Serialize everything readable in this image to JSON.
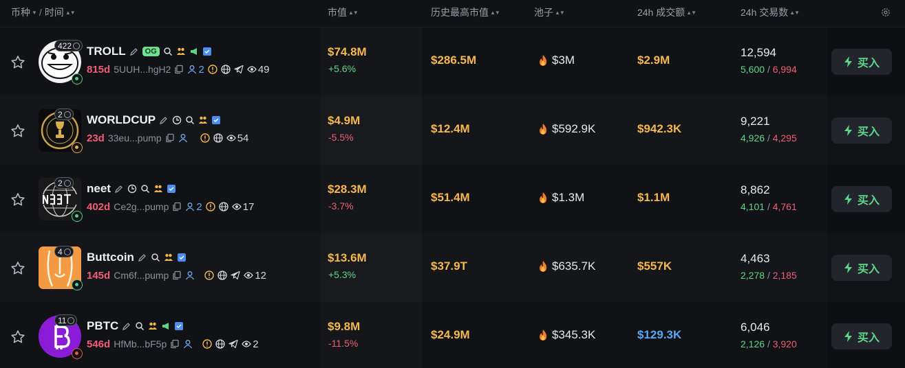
{
  "header": {
    "col_coin": "币种",
    "sep": "/",
    "col_time": "时间",
    "col_mcap": "市值",
    "col_ath": "历史最高市值",
    "col_pool": "池子",
    "col_volume": "24h 成交额",
    "col_txs": "24h 交易数"
  },
  "colors": {
    "accent_orange": "#f5b84c",
    "up": "#5ed68a",
    "down": "#f05e78",
    "blue": "#5aa6f5"
  },
  "buy_label": "买入",
  "rows": [
    {
      "holders": "422",
      "name": "TROLL",
      "og": "OG",
      "age": "815d",
      "address": "5UUH...hgH2",
      "holder_count": "2",
      "views": "49",
      "mcap": "$74.8M",
      "mcap_change": "+5.6%",
      "ath": "$286.5M",
      "pool": "$3M",
      "volume": "$2.9M",
      "txs": "12,594",
      "buys": "5,600",
      "slash": "/",
      "sells": "6,994"
    },
    {
      "holders": "2",
      "name": "WORLDCUP",
      "age": "23d",
      "address": "33eu...pump",
      "views": "54",
      "mcap": "$4.9M",
      "mcap_change": "-5.5%",
      "ath": "$12.4M",
      "pool": "$592.9K",
      "volume": "$942.3K",
      "txs": "9,221",
      "buys": "4,926",
      "slash": "/",
      "sells": "4,295"
    },
    {
      "holders": "2",
      "name": "neet",
      "age": "402d",
      "address": "Ce2g...pump",
      "holder_count": "2",
      "views": "17",
      "mcap": "$28.3M",
      "mcap_change": "-3.7%",
      "ath": "$51.4M",
      "pool": "$1.3M",
      "volume": "$1.1M",
      "txs": "8,862",
      "buys": "4,101",
      "slash": "/",
      "sells": "4,761"
    },
    {
      "holders": "4",
      "name": "Buttcoin",
      "age": "145d",
      "address": "Cm6f...pump",
      "views": "12",
      "mcap": "$13.6M",
      "mcap_change": "+5.3%",
      "ath": "$37.9T",
      "pool": "$635.7K",
      "volume": "$557K",
      "txs": "4,463",
      "buys": "2,278",
      "slash": "/",
      "sells": "2,185"
    },
    {
      "holders": "11",
      "name": "PBTC",
      "age": "546d",
      "address": "HfMb...bF5p",
      "views": "2",
      "mcap": "$9.8M",
      "mcap_change": "-11.5%",
      "ath": "$24.9M",
      "pool": "$345.3K",
      "volume": "$129.3K",
      "txs": "6,046",
      "buys": "2,126",
      "slash": "/",
      "sells": "3,920"
    }
  ]
}
